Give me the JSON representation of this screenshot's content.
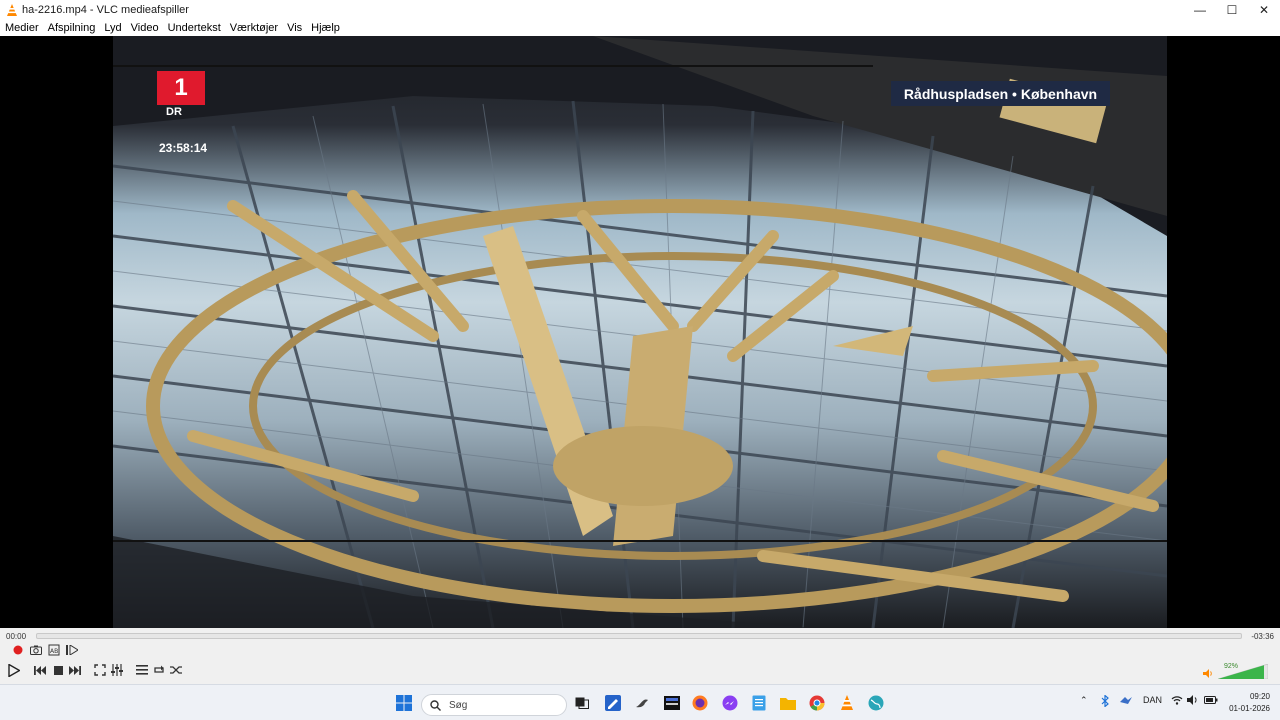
{
  "window": {
    "title": "ha-2216.mp4 - VLC medieafspiller",
    "minimize": "—",
    "maximize": "☐",
    "close": "✕"
  },
  "menu": [
    "Medier",
    "Afspilning",
    "Lyd",
    "Video",
    "Undertekst",
    "Værktøjer",
    "Vis",
    "Hjælp"
  ],
  "video": {
    "caption": "Rådhuspladsen • København",
    "channel_logo": "1",
    "channel_sub": "DR",
    "timestamp": "23:58:14"
  },
  "playback": {
    "elapsed": "00:00",
    "remaining": "-03:36",
    "progress": 0.0,
    "volume_label": "92%",
    "volume": 0.92
  },
  "taskbar": {
    "search_placeholder": "Søg",
    "language": "DAN",
    "time": "09:20",
    "date": "01-01-2026"
  },
  "colors": {
    "vlc_orange": "#ff8800",
    "record_red": "#e02020",
    "volume_green": "#3bb54a",
    "caption_bg": "#1f2a44",
    "dr_red": "#e01a2d"
  }
}
